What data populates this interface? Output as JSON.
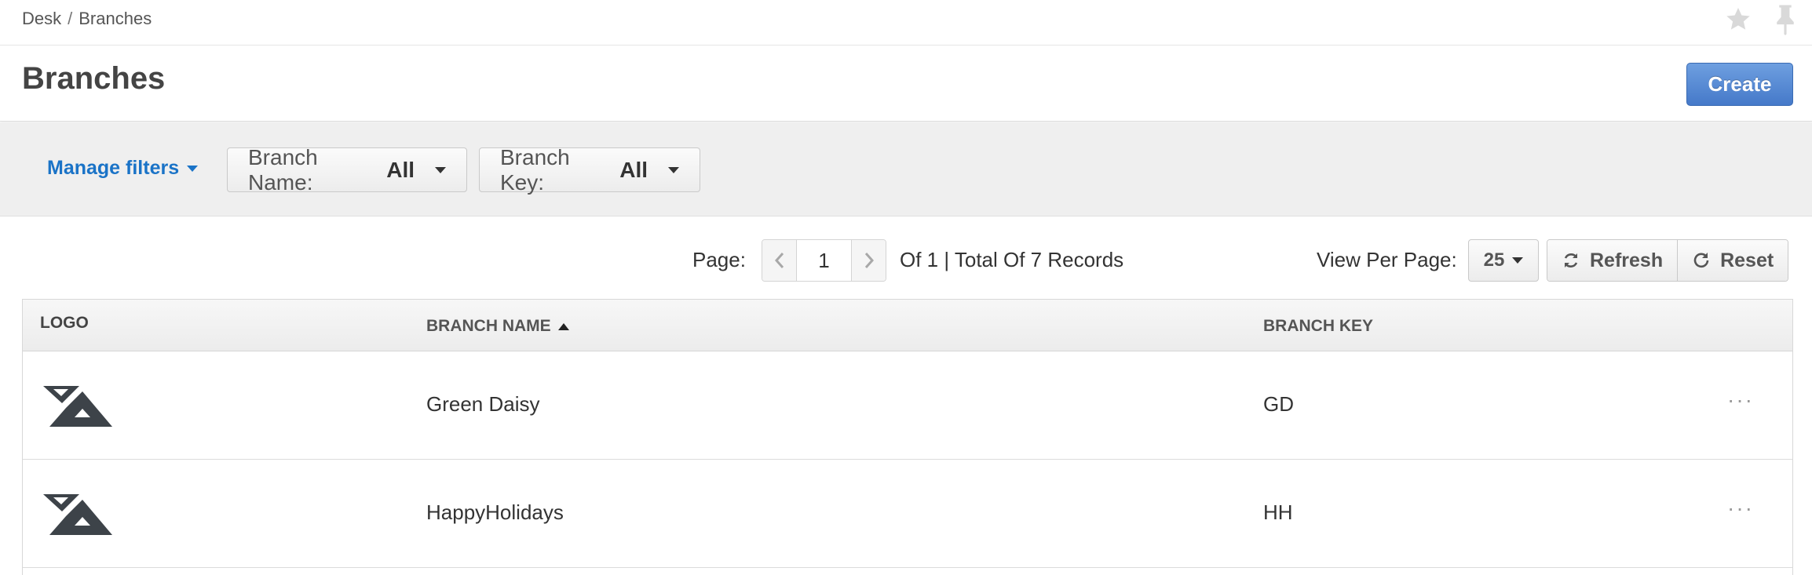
{
  "breadcrumb": {
    "root": "Desk",
    "separator": "/",
    "current": "Branches"
  },
  "header": {
    "title": "Branches",
    "create_label": "Create"
  },
  "filters": {
    "manage_label": "Manage filters",
    "branch_name": {
      "label": "Branch Name:",
      "value": "All"
    },
    "branch_key": {
      "label": "Branch Key:",
      "value": "All"
    }
  },
  "pager": {
    "page_label": "Page:",
    "current_page": "1",
    "summary": "Of 1 | Total Of 7 Records",
    "per_page_label": "View Per Page:",
    "per_page_value": "25",
    "refresh_label": "Refresh",
    "reset_label": "Reset"
  },
  "table": {
    "columns": {
      "logo": "LOGO",
      "branch_name": "BRANCH NAME",
      "branch_key": "BRANCH KEY"
    },
    "sort": {
      "column": "branch_name",
      "direction": "ascending"
    },
    "rows": [
      {
        "name": "Green Daisy",
        "key": "GD",
        "more": "···"
      },
      {
        "name": "HappyHolidays",
        "key": "HH",
        "more": "···"
      }
    ]
  },
  "colors": {
    "accent": "#1a73c7",
    "primary_button": "#4f86d4",
    "logo": "#3d4349"
  }
}
